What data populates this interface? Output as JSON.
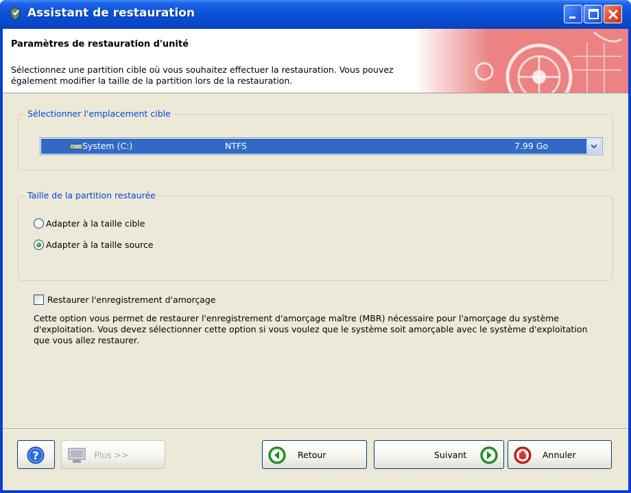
{
  "window": {
    "title": "Assistant de restauration"
  },
  "header": {
    "title": "Paramètres de restauration d'unité",
    "description": "Sélectionnez une partition cible où vous souhaitez effectuer la restauration. Vous pouvez également modifier la taille de la partition lors de la restauration."
  },
  "target_group": {
    "legend": "Sélectionner l'emplacement cible",
    "selected": {
      "name": "System (C:)",
      "filesystem": "NTFS",
      "size": "7.99 Go"
    }
  },
  "size_group": {
    "legend": "Taille de la partition restaurée",
    "options": [
      {
        "label": "Adapter à la taille cible",
        "checked": false
      },
      {
        "label": "Adapter à la taille source",
        "checked": true
      }
    ]
  },
  "mbr": {
    "label": "Restaurer l'enregistrement d'amorçage",
    "checked": false,
    "description": "Cette option vous permet de restaurer l'enregistrement d'amorçage maître (MBR) nécessaire pour l'amorçage du système d'exploitation. Vous devez sélectionner cette option si vous voulez que le système soit amorçable avec le système d'exploitation que vous allez restaurer."
  },
  "buttons": {
    "plus": "Plus >>",
    "back": "Retour",
    "next": "Suivant",
    "cancel": "Annuler"
  },
  "icons": {
    "title": "app-shield-icon",
    "help": "question-icon",
    "plus": "computer-icon",
    "back": "back-arrow-icon",
    "next": "forward-arrow-icon",
    "cancel": "stop-hand-icon",
    "drive": "hard-drive-icon"
  },
  "colors": {
    "title_bar": "#0b52d8",
    "selection": "#316ac5",
    "legend_text": "#0046d5",
    "dialog_bg": "#ece9d8"
  }
}
